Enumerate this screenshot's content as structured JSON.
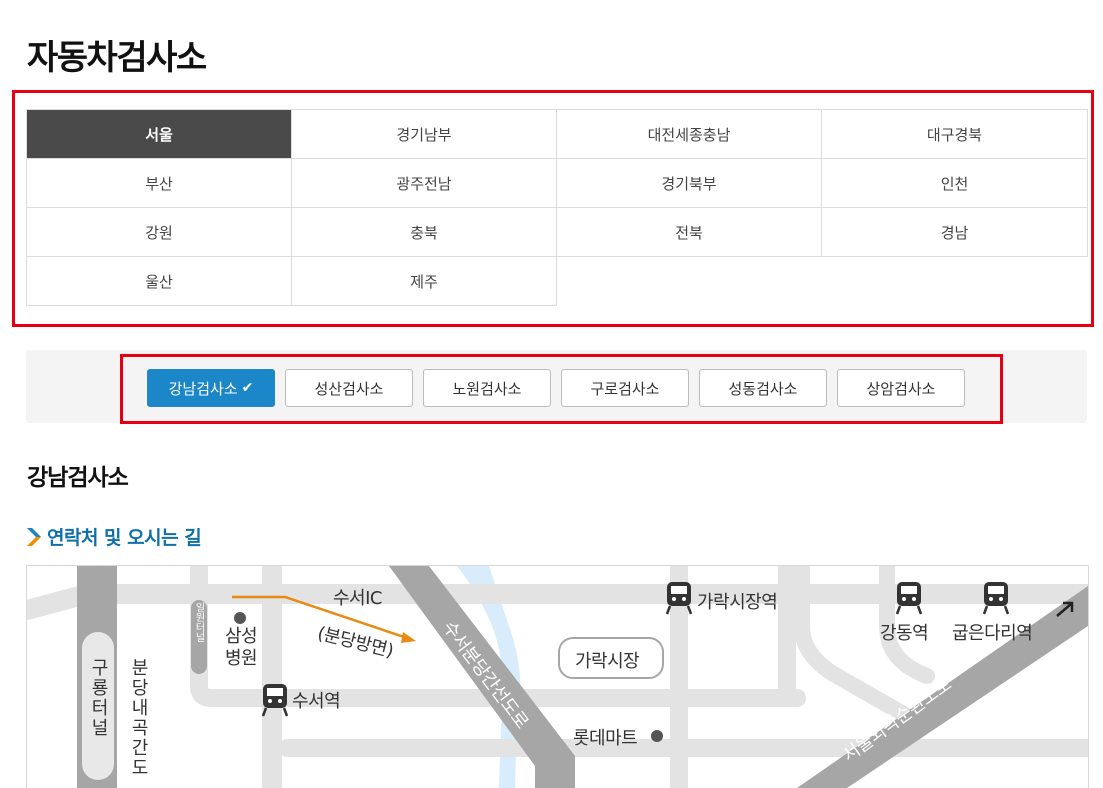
{
  "page_title": "자동차검사소",
  "regions": [
    {
      "label": "서울",
      "active": true
    },
    {
      "label": "경기남부"
    },
    {
      "label": "대전세종충남"
    },
    {
      "label": "대구경북"
    },
    {
      "label": "부산"
    },
    {
      "label": "광주전남"
    },
    {
      "label": "경기북부"
    },
    {
      "label": "인천"
    },
    {
      "label": "강원"
    },
    {
      "label": "충북"
    },
    {
      "label": "전북"
    },
    {
      "label": "경남"
    },
    {
      "label": "울산"
    },
    {
      "label": "제주"
    }
  ],
  "centers": [
    {
      "label": "강남검사소",
      "active": true
    },
    {
      "label": "성산검사소"
    },
    {
      "label": "노원검사소"
    },
    {
      "label": "구로검사소"
    },
    {
      "label": "성동검사소"
    },
    {
      "label": "상암검사소"
    }
  ],
  "section_title": "강남검사소",
  "sub_title": "연락처 및 오시는 길",
  "map": {
    "labels": {
      "suseo_ic": "수서IC",
      "bundang_dir": "(분당방면)",
      "garak_station": "가락시장역",
      "gangdong_station": "강동역",
      "gubeun_station": "굽은다리역",
      "samsung_hospital": "삼성병원",
      "ilwon_tunnel": "일원터널",
      "guryong_tunnel": "구룡터널",
      "bundang_road": "분당내곡간도",
      "suseo_station": "수서역",
      "garak_market": "가락시장",
      "lotte_mart": "롯데마트",
      "songpa_road": "수서분당간선도로",
      "ring_road": "서울외곽순환도로"
    },
    "colors": {
      "road": "#e3e3e3",
      "highway": "#a6a6a6",
      "river": "#d9ecfb",
      "route": "#e98a12"
    }
  }
}
